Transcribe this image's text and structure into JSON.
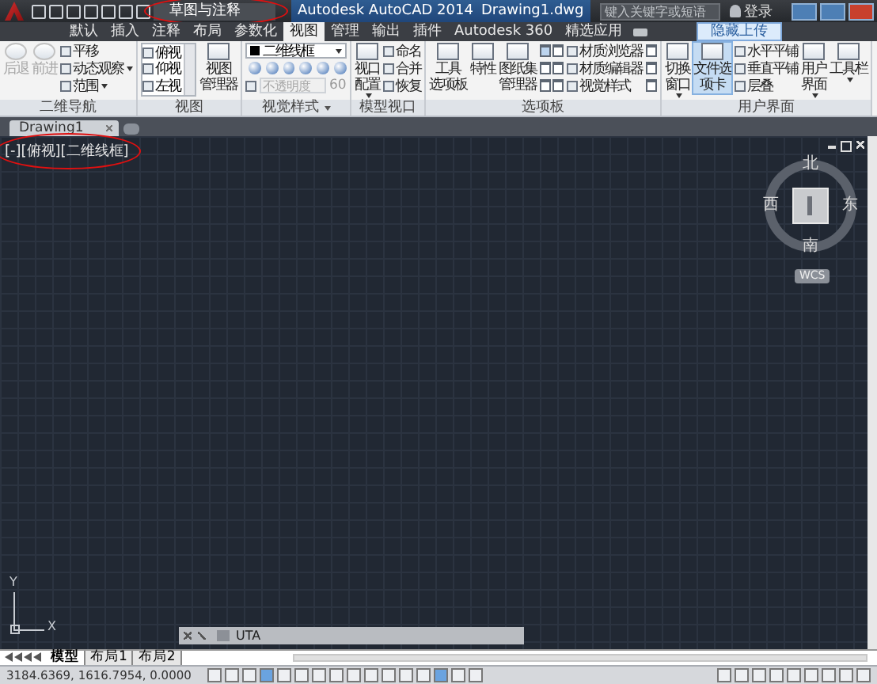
{
  "quick_access": {
    "workspace": "草图与注释",
    "circled": true
  },
  "title": {
    "app": "Autodesk AutoCAD 2014",
    "file": "Drawing1.dwg"
  },
  "search": {
    "placeholder": "键入关键字或短语"
  },
  "sign_in": "登录",
  "ribbon_tabs": [
    {
      "label": "默认",
      "selected": false
    },
    {
      "label": "插入",
      "selected": false
    },
    {
      "label": "注释",
      "selected": false
    },
    {
      "label": "布局",
      "selected": false
    },
    {
      "label": "参数化",
      "selected": false
    },
    {
      "label": "视图",
      "selected": true
    },
    {
      "label": "管理",
      "selected": false
    },
    {
      "label": "输出",
      "selected": false
    },
    {
      "label": "插件",
      "selected": false
    },
    {
      "label": "Autodesk 360",
      "selected": false
    },
    {
      "label": "精选应用",
      "selected": false
    }
  ],
  "upload_tooltip": "隐藏上传",
  "panels": [
    {
      "title": "二维导航",
      "has_menu": false,
      "columns": [
        {
          "kind": "large",
          "lines": [
            "后退"
          ],
          "menu": false,
          "disabled": true,
          "selected": false
        },
        {
          "kind": "large",
          "lines": [
            "前进"
          ],
          "menu": false,
          "disabled": true,
          "selected": false
        },
        {
          "kind": "stack",
          "items": [
            {
              "label": "平移",
              "menu": false
            },
            {
              "label": "动态观察",
              "menu": true
            },
            {
              "label": "范围",
              "menu": true
            }
          ]
        }
      ]
    },
    {
      "title": "视图",
      "has_menu": false,
      "columns": [
        {
          "kind": "list",
          "items": [
            "俯视",
            "仰视",
            "左视"
          ]
        },
        {
          "kind": "large",
          "lines": [
            "视图",
            "管理器"
          ],
          "menu": false,
          "disabled": false,
          "selected": false
        }
      ]
    },
    {
      "title": "视觉样式",
      "has_menu": true,
      "columns": [
        {
          "kind": "style",
          "dropdown": "二维线框",
          "opacity": {
            "placeholder": "不透明度",
            "value": "60"
          }
        }
      ]
    },
    {
      "title": "模型视口",
      "has_menu": false,
      "columns": [
        {
          "kind": "large",
          "lines": [
            "视口",
            "配置"
          ],
          "menu": true,
          "disabled": false,
          "selected": false
        },
        {
          "kind": "stack",
          "items": [
            {
              "label": "命名",
              "menu": false
            },
            {
              "label": "合并",
              "menu": false
            },
            {
              "label": "恢复",
              "menu": false
            }
          ]
        }
      ]
    },
    {
      "title": "选项板",
      "has_menu": false,
      "columns": [
        {
          "kind": "large",
          "lines": [
            "工具",
            "选项板"
          ],
          "menu": false,
          "disabled": false,
          "selected": false
        },
        {
          "kind": "large",
          "lines": [
            "特性"
          ],
          "menu": false,
          "disabled": false,
          "selected": false
        },
        {
          "kind": "large",
          "lines": [
            "图纸集",
            "管理器"
          ],
          "menu": false,
          "disabled": false,
          "selected": false
        },
        {
          "kind": "icon_grid"
        },
        {
          "kind": "stack",
          "items": [
            {
              "label": "材质浏览器",
              "menu": false
            },
            {
              "label": "材质编辑器",
              "menu": false
            },
            {
              "label": "视觉样式",
              "menu": false
            }
          ]
        },
        {
          "kind": "icon_column"
        }
      ]
    },
    {
      "title": "用户界面",
      "has_menu": false,
      "columns": [
        {
          "kind": "large",
          "lines": [
            "切换",
            "窗口"
          ],
          "menu": true,
          "disabled": false,
          "selected": false
        },
        {
          "kind": "large",
          "lines": [
            "文件选",
            "项卡"
          ],
          "menu": false,
          "disabled": false,
          "selected": true
        },
        {
          "kind": "stack",
          "items": [
            {
              "label": "水平平铺",
              "menu": false
            },
            {
              "label": "垂直平铺",
              "menu": false
            },
            {
              "label": "层叠",
              "menu": false
            }
          ]
        },
        {
          "kind": "large",
          "lines": [
            "用户",
            "界面"
          ],
          "menu": true,
          "disabled": false,
          "selected": false
        },
        {
          "kind": "large",
          "lines": [
            "工具栏"
          ],
          "menu": true,
          "disabled": false,
          "selected": false
        }
      ]
    }
  ],
  "doc_tabs": [
    {
      "label": "Drawing1",
      "selected": true
    }
  ],
  "viewport_label": {
    "text": "[-][俯视][二维线框]",
    "circled": true
  },
  "viewcube": {
    "north": "北",
    "south": "南",
    "east": "东",
    "west": "西",
    "wcs": "WCS"
  },
  "ucs": {
    "x": "X",
    "y": "Y"
  },
  "command_line": {
    "value": "UTA"
  },
  "layout_tabs": [
    {
      "label": "模型",
      "selected": true
    },
    {
      "label": "布局1",
      "selected": false
    },
    {
      "label": "布局2",
      "selected": false
    }
  ],
  "status": {
    "coordinates": "3184.6369, 1616.7954, 0.0000"
  }
}
